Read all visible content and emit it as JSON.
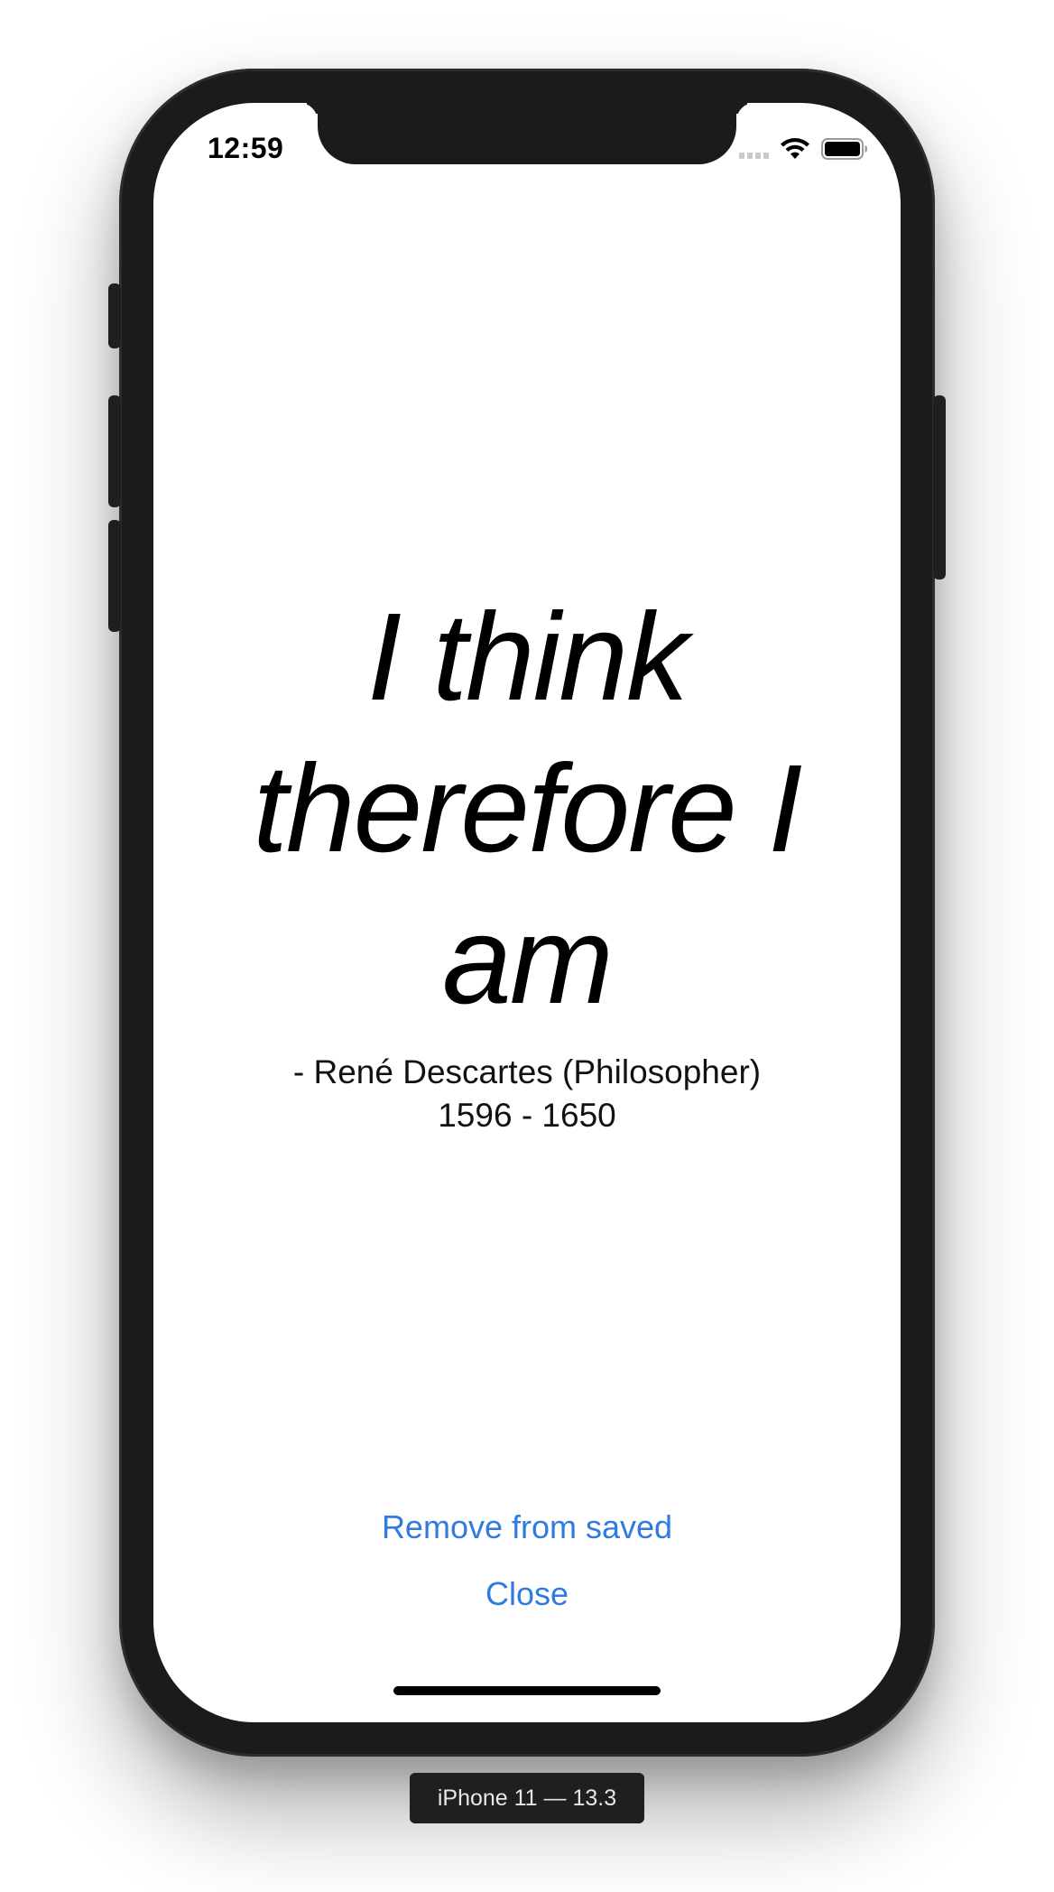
{
  "status_bar": {
    "time": "12:59",
    "icons": [
      "cellular-signal-icon",
      "wifi-icon",
      "battery-icon"
    ]
  },
  "quote": {
    "text": "I think therefore I am",
    "author": "- René Descartes (Philosopher)",
    "years": "1596 - 1650"
  },
  "actions": {
    "remove_label": "Remove from saved",
    "close_label": "Close"
  },
  "device_label": "iPhone 11 — 13.3",
  "colors": {
    "link": "#2f7bde",
    "frame": "#1b1b1c",
    "text": "#000000"
  }
}
